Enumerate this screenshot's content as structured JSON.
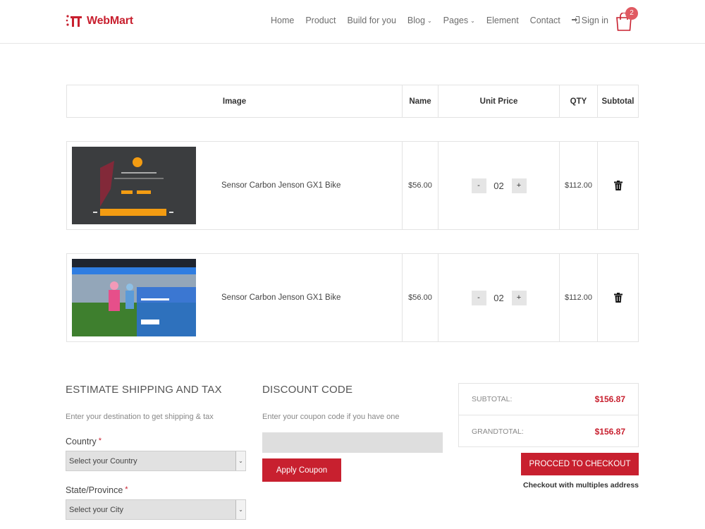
{
  "header": {
    "brand": "WebMart",
    "nav": [
      "Home",
      "Product",
      "Build for you",
      "Blog",
      "Pages",
      "Element",
      "Contact"
    ],
    "nav_dropdowns": [
      "Blog",
      "Pages"
    ],
    "signin": "Sign in",
    "cart_count": "2"
  },
  "table": {
    "headers": {
      "image": "Image",
      "name": "Name",
      "unit_price": "Unit Price",
      "qty": "QTY",
      "subtotal": "Subtotal"
    },
    "rows": [
      {
        "name": "Sensor Carbon Jenson GX1 Bike",
        "price": "$56.00",
        "qty": "02",
        "subtotal": "$112.00",
        "minus": "-",
        "plus": "+"
      },
      {
        "name": "Sensor Carbon Jenson GX1 Bike",
        "price": "$56.00",
        "qty": "02",
        "subtotal": "$112.00",
        "minus": "-",
        "plus": "+"
      }
    ]
  },
  "shipping": {
    "title": "ESTIMATE SHIPPING AND TAX",
    "desc": "Enter your destination to get shipping & tax",
    "country_label": "Country",
    "country_value": "Select your Country",
    "state_label": "State/Province",
    "state_value": "Select your City",
    "required_mark": "*"
  },
  "discount": {
    "title": "DISCOUNT CODE",
    "desc": "Enter your coupon code if you have one",
    "coupon_value": "",
    "apply_label": "Apply Coupon"
  },
  "totals": {
    "subtotal_label": "SUBTOTAL:",
    "subtotal_value": "$156.87",
    "grandtotal_label": "GRANDTOTAL:",
    "grandtotal_value": "$156.87",
    "checkout_label": "PROCCED TO CHECKOUT",
    "multi_label": "Checkout with multiples address"
  },
  "colors": {
    "accent": "#c8202f",
    "badge": "#e05a62",
    "row_thumb_orange": "#f39c12"
  },
  "icons": {
    "signin": "sign-in-icon",
    "cart": "shopping-bag-icon",
    "delete": "trash-icon",
    "dropdown": "chevron-down-icon"
  }
}
